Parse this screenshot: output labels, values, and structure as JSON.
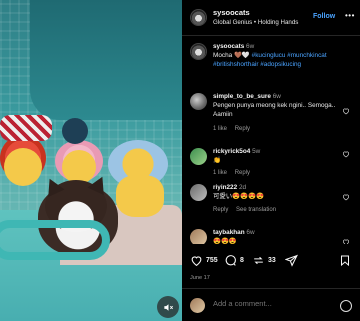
{
  "header": {
    "username": "sysoocats",
    "subtitle": "Global Genius • Holding Hands",
    "follow_label": "Follow",
    "more_icon": "more-horizontal-icon"
  },
  "caption": {
    "username": "sysoocats",
    "time": "6w",
    "text": "Mocha 🤎🤍",
    "tags": "#kucinglucu #munchkincat #britishshorthair #adopsikucing"
  },
  "comments": [
    {
      "username": "simple_to_be_sure",
      "time": "6w",
      "text": "Pengen punya meong kek ngini.. Semoga.. Aamiin",
      "likes": "1 like",
      "reply_label": "Reply"
    },
    {
      "username": "rickyrick5o4",
      "time": "5w",
      "text": "👏",
      "likes": "1 like",
      "reply_label": "Reply"
    },
    {
      "username": "riyin222",
      "time": "2d",
      "text": "可愛い😍😍😍😍",
      "reply_label": "Reply",
      "translation_label": "See translation"
    },
    {
      "username": "taybakhan",
      "time": "6w",
      "text": "😍😍😍"
    }
  ],
  "actions": {
    "like_count": "755",
    "comment_count": "8",
    "share_count": "33"
  },
  "date": "June 17",
  "add_comment": {
    "placeholder": "Add a comment..."
  },
  "colors": {
    "accent": "#4aa3ff",
    "background": "#000000",
    "text": "#f5f5f5",
    "muted": "#9a9a9a"
  }
}
